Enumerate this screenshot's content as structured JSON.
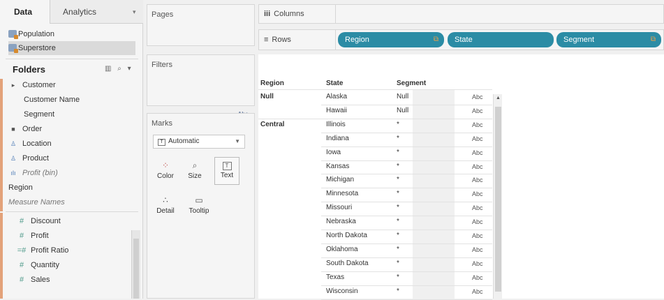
{
  "tabs": {
    "data": "Data",
    "analytics": "Analytics",
    "menu": "▾"
  },
  "datasources": [
    {
      "label": "Population"
    },
    {
      "label": "Superstore"
    }
  ],
  "folders": {
    "title": "Folders",
    "tools": "▥ ⌕ ▾"
  },
  "dimensions": [
    {
      "label": "Customer",
      "icon": "folder-open-icon",
      "glyph": "▸"
    },
    {
      "label": "Customer Name",
      "icon": "abc-icon",
      "glyph": "Abc"
    },
    {
      "label": "Segment",
      "icon": "abc-icon",
      "glyph": "Abc"
    },
    {
      "label": "Order",
      "icon": "folder-icon",
      "glyph": "■"
    },
    {
      "label": "Location",
      "icon": "hierarchy-icon",
      "glyph": "♙"
    },
    {
      "label": "Product",
      "icon": "hierarchy-icon",
      "glyph": "♙"
    },
    {
      "label": "Profit (bin)",
      "icon": "bin-icon",
      "glyph": "ılı"
    },
    {
      "label": "Region",
      "icon": "abc-icon",
      "glyph": "Abc"
    },
    {
      "label": "Measure Names",
      "icon": "abc-icon",
      "glyph": "Abc"
    }
  ],
  "measures": [
    {
      "label": "Discount",
      "glyph": "#"
    },
    {
      "label": "Profit",
      "glyph": "#"
    },
    {
      "label": "Profit Ratio",
      "glyph": "=#"
    },
    {
      "label": "Quantity",
      "glyph": "#"
    },
    {
      "label": "Sales",
      "glyph": "#"
    }
  ],
  "cards": {
    "pages": "Pages",
    "filters": "Filters",
    "marks": "Marks"
  },
  "marks": {
    "type": "Automatic",
    "type_icon": "T",
    "buttons": [
      {
        "label": "Color",
        "glyph": "⁘"
      },
      {
        "label": "Size",
        "glyph": "⌕"
      },
      {
        "label": "Text",
        "glyph": "T"
      },
      {
        "label": "Detail",
        "glyph": "∴"
      },
      {
        "label": "Tooltip",
        "glyph": "▭"
      }
    ]
  },
  "shelves": {
    "columns": "Columns",
    "columns_icon": "iii",
    "rows": "Rows",
    "rows_icon": "≡",
    "row_pills": [
      "Region",
      "State",
      "Segment"
    ]
  },
  "table": {
    "headers": {
      "region": "Region",
      "state": "State",
      "segment": "Segment"
    },
    "cell_text": "Abc",
    "rows": [
      {
        "region": "Null",
        "state": "Alaska",
        "segment": "Null"
      },
      {
        "region": "",
        "state": "Hawaii",
        "segment": "Null"
      },
      {
        "region": "Central",
        "state": "Illinois",
        "segment": "*"
      },
      {
        "region": "",
        "state": "Indiana",
        "segment": "*"
      },
      {
        "region": "",
        "state": "Iowa",
        "segment": "*"
      },
      {
        "region": "",
        "state": "Kansas",
        "segment": "*"
      },
      {
        "region": "",
        "state": "Michigan",
        "segment": "*"
      },
      {
        "region": "",
        "state": "Minnesota",
        "segment": "*"
      },
      {
        "region": "",
        "state": "Missouri",
        "segment": "*"
      },
      {
        "region": "",
        "state": "Nebraska",
        "segment": "*"
      },
      {
        "region": "",
        "state": "North Dakota",
        "segment": "*"
      },
      {
        "region": "",
        "state": "Oklahoma",
        "segment": "*"
      },
      {
        "region": "",
        "state": "South Dakota",
        "segment": "*"
      },
      {
        "region": "",
        "state": "Texas",
        "segment": "*"
      },
      {
        "region": "",
        "state": "Wisconsin",
        "segment": "*"
      }
    ]
  }
}
